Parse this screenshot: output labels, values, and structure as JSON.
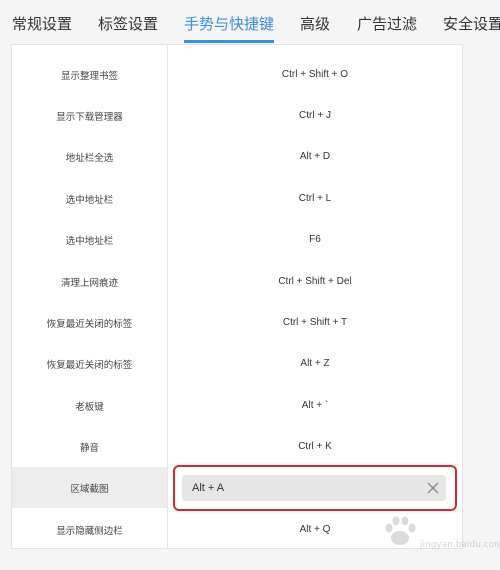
{
  "tabs": [
    {
      "label": "常规设置",
      "active": false
    },
    {
      "label": "标签设置",
      "active": false
    },
    {
      "label": "手势与快捷键",
      "active": true
    },
    {
      "label": "高级",
      "active": false
    },
    {
      "label": "广告过滤",
      "active": false
    },
    {
      "label": "安全设置",
      "active": false
    }
  ],
  "shortcuts": [
    {
      "name": "显示整理书签",
      "key": "Ctrl + Shift + O"
    },
    {
      "name": "显示下载管理器",
      "key": "Ctrl + J"
    },
    {
      "name": "地址栏全选",
      "key": "Alt + D"
    },
    {
      "name": "选中地址栏",
      "key": "Ctrl + L"
    },
    {
      "name": "选中地址栏",
      "key": "F6"
    },
    {
      "name": "清理上网痕迹",
      "key": "Ctrl + Shift + Del"
    },
    {
      "name": "恢复最近关闭的标签",
      "key": "Ctrl + Shift + T"
    },
    {
      "name": "恢复最近关闭的标签",
      "key": "Alt + Z"
    },
    {
      "name": "老板键",
      "key": "Alt + `"
    },
    {
      "name": "静音",
      "key": "Ctrl + K"
    },
    {
      "name": "区域截图",
      "key": "Alt + A",
      "editing": true
    },
    {
      "name": "显示隐藏侧边栏",
      "key": "Alt + Q"
    }
  ],
  "colors": {
    "accent": "#3a8ee6",
    "highlight_border": "#e0242b"
  },
  "icons": {
    "clear": "close-icon",
    "watermark": "baidu-paw-logo"
  },
  "watermark": {
    "text": "jingyan.baidu.com"
  }
}
